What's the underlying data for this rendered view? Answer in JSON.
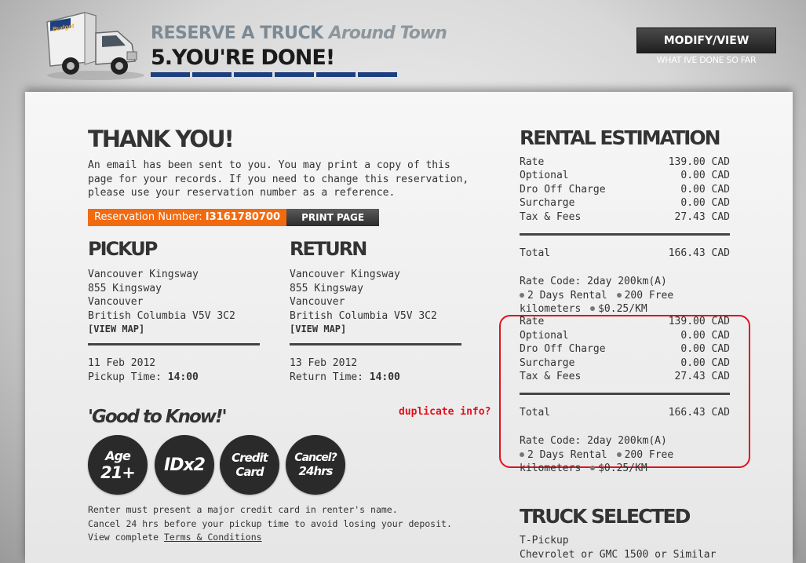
{
  "header": {
    "line1_main": "RESERVE A TRUCK",
    "line1_italic": "Around Town",
    "step": "5.YOU'RE DONE!",
    "modify_button": "MODIFY/VIEW",
    "modify_sub": "WHAT IVE DONE SO FAR",
    "progress_segments": 6,
    "truck_brand": "Budget"
  },
  "thankyou": {
    "title": "THANK YOU!",
    "lines": [
      "An email has been sent to you. You may print a copy of this",
      "page for your records. If you need to change this reservation,",
      "please use your reservation number as a reference."
    ],
    "reservation_label": "Reservation Number:",
    "reservation_number": "I3161780700",
    "print_button": "PRINT PAGE"
  },
  "pickup": {
    "title": "PICKUP",
    "location": "Vancouver Kingsway",
    "street": "855 Kingsway",
    "city": "Vancouver",
    "province_postal": "British Columbia V5V 3C2",
    "map_link": "[VIEW MAP]",
    "date": "11 Feb 2012",
    "time_label": "Pickup Time:",
    "time": "14:00"
  },
  "return": {
    "title": "RETURN",
    "location": "Vancouver Kingsway",
    "street": "855 Kingsway",
    "city": "Vancouver",
    "province_postal": "British Columbia V5V 3C2",
    "map_link": "[VIEW MAP]",
    "date": "13 Feb 2012",
    "time_label": "Return Time:",
    "time": "14:00"
  },
  "good_to_know": {
    "title": "'Good to Know!'",
    "badges": [
      {
        "line1": "Age",
        "line2": "21+"
      },
      {
        "line1": "IDx2",
        "line2": ""
      },
      {
        "line1": "Credit",
        "line2": "Card"
      },
      {
        "line1": "Cancel?",
        "line2": "24hrs"
      }
    ],
    "note1": "Renter must present a major credit card in renter's name.",
    "note2": "Cancel 24 hrs before your pickup time to avoid losing your deposit.",
    "note3_prefix": "View complete",
    "terms_link": "Terms & Conditions"
  },
  "annotation": {
    "text": "duplicate info?"
  },
  "estimation": {
    "title": "RENTAL ESTIMATION",
    "rows": [
      {
        "label": "Rate",
        "value": "139.00 CAD"
      },
      {
        "label": "Optional",
        "value": "0.00 CAD"
      },
      {
        "label": "Dro Off Charge",
        "value": "0.00 CAD"
      },
      {
        "label": "Surcharge",
        "value": "0.00 CAD"
      },
      {
        "label": "Tax & Fees",
        "value": "27.43 CAD"
      }
    ],
    "total_label": "Total",
    "total_value": "166.43 CAD",
    "rate_code": "Rate Code: 2day 200km(A)",
    "days_rental": "2 Days Rental",
    "free_km": "200 Free",
    "km_line": "kilometers",
    "per_km": "$0.25/KM"
  },
  "estimation_dup": {
    "rows": [
      {
        "label": "Rate",
        "value": "139.00 CAD"
      },
      {
        "label": "Optional",
        "value": "0.00 CAD"
      },
      {
        "label": "Dro Off Charge",
        "value": "0.00 CAD"
      },
      {
        "label": "Surcharge",
        "value": "0.00 CAD"
      },
      {
        "label": "Tax & Fees",
        "value": "27.43 CAD"
      }
    ],
    "total_label": "Total",
    "total_value": "166.43 CAD",
    "rate_code": "Rate Code: 2day 200km(A)",
    "days_rental": "2 Days Rental",
    "free_km": "200 Free",
    "km_line": "kilometers",
    "per_km": "$0.25/KM"
  },
  "truck": {
    "title": "TRUCK SELECTED",
    "type": "T-Pickup",
    "model": "Chevrolet or GMC 1500 or Similar"
  }
}
